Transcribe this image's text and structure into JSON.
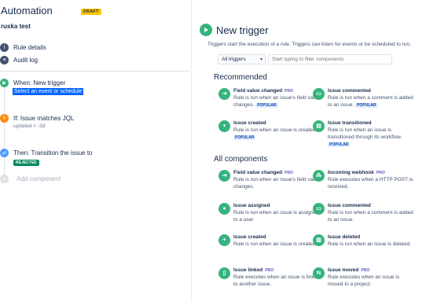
{
  "app": {
    "title": "Automation",
    "draft_badge": "DRAFT",
    "rule_name": "ruska test"
  },
  "nav": [
    {
      "label": "Rule details",
      "icon": "info-icon"
    },
    {
      "label": "Audit log",
      "icon": "list-icon"
    }
  ],
  "steps": {
    "trigger": {
      "title": "When: New trigger",
      "placeholder": "Select an event or schedule"
    },
    "condition": {
      "title": "If: Issue matches JQL",
      "sub": "updated < -3d"
    },
    "action": {
      "title": "Then: Transition the issue to",
      "badge": "REJECTED"
    },
    "add": {
      "label": "Add component"
    }
  },
  "panel": {
    "title": "New trigger",
    "description": "Triggers start the execution of a rule. Triggers can listen for events or be scheduled to run.",
    "dropdown_value": "All triggers",
    "filter_placeholder": "Start typing to filter components",
    "recommended_heading": "Recommended",
    "all_heading": "All components"
  },
  "recommended": [
    {
      "name": "Field value changed",
      "pro": "PRO",
      "desc": "Rule is run when an issue's field value changes.",
      "popular": "POPULAR",
      "icon": "field-change-icon"
    },
    {
      "name": "Issue commented",
      "pro": "",
      "desc": "Rule is run when a comment is added to an issue.",
      "popular": "POPULAR",
      "icon": "comment-icon"
    },
    {
      "name": "Issue created",
      "pro": "",
      "desc": "Rule is run when an issue is created.",
      "popular": "POPULAR",
      "icon": "plus-icon"
    },
    {
      "name": "Issue transitioned",
      "pro": "",
      "desc": "Rule is run when an issue is transitioned through its workflow.",
      "popular": "POPULAR",
      "icon": "transition-icon"
    }
  ],
  "all": [
    {
      "name": "Field value changed",
      "pro": "PRO",
      "desc": "Rule is run when an issue's field value changes.",
      "icon": "field-change-icon"
    },
    {
      "name": "Incoming webhook",
      "pro": "PRO",
      "desc": "Rule executes when a HTTP POST is received.",
      "icon": "webhook-icon"
    },
    {
      "name": "Issue assigned",
      "pro": "",
      "desc": "Rule is run when an issue is assigned to a user.",
      "icon": "user-icon"
    },
    {
      "name": "Issue commented",
      "pro": "",
      "desc": "Rule is run when a comment is added to an issue.",
      "icon": "comment-icon"
    },
    {
      "name": "Issue created",
      "pro": "",
      "desc": "Rule is run when an issue is created.",
      "icon": "plus-icon"
    },
    {
      "name": "Issue deleted",
      "pro": "",
      "desc": "Rule is run when an issue is deleted.",
      "icon": "trash-icon"
    },
    {
      "name": "Issue linked",
      "pro": "PRO",
      "desc": "Rule executes when an issue is linked to another issue.",
      "icon": "link-icon"
    },
    {
      "name": "Issue moved",
      "pro": "PRO",
      "desc": "Rule executes when an issue is moved to a project.",
      "icon": "move-icon"
    }
  ],
  "colors": {
    "accent_green": "#36b37e",
    "draft": "#ffc400",
    "select_highlight": "#0065ff",
    "rejected": "#00875a"
  }
}
